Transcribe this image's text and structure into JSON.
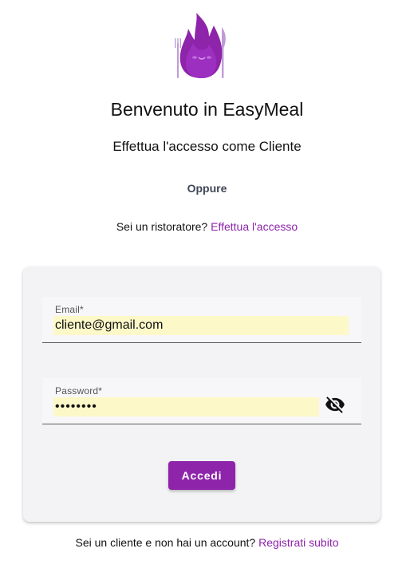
{
  "app": {
    "title": "Benvenuto in EasyMeal",
    "subtitle": "Effettua l'accesso come Cliente",
    "divider": "Oppure",
    "logo_icon": "flame-mascot-icon"
  },
  "restaurant_login": {
    "prompt": "Sei un ristoratore?",
    "link": "Effettua l'accesso"
  },
  "form": {
    "email": {
      "label": "Email*",
      "value": "cliente@gmail.com"
    },
    "password": {
      "label": "Password*",
      "value": "password",
      "toggle_icon": "eye-off-icon"
    },
    "submit_label": "Accedi"
  },
  "signup": {
    "prompt": "Sei un cliente e non hai un account?",
    "link": "Registrati subito"
  },
  "colors": {
    "accent": "#8e24aa",
    "card_bg": "#f3f3f5",
    "autofill_bg": "#fdf8c8"
  }
}
